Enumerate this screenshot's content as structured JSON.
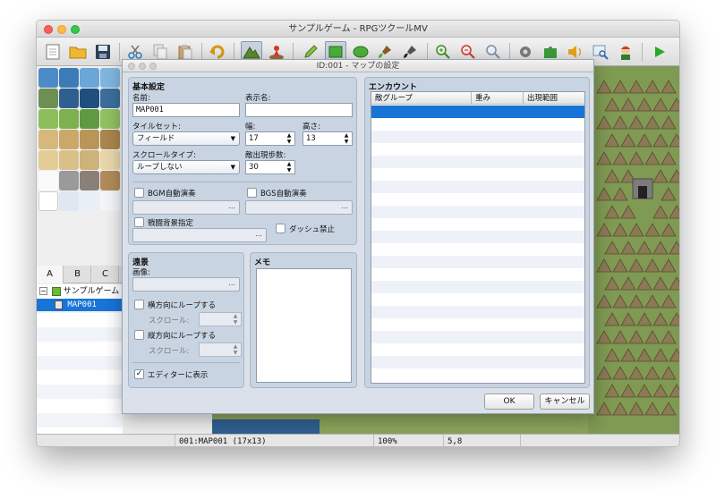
{
  "window": {
    "title": "サンプルゲーム - RPGツクールMV"
  },
  "toolbar": {
    "buttons": [
      "new-project",
      "open-project",
      "save-project",
      "cut",
      "copy",
      "paste",
      "undo",
      "map-mode",
      "event-mode",
      "pencil",
      "rectangle",
      "ellipse",
      "flood-fill",
      "shadow-pen",
      "zoom-in",
      "zoom-out",
      "actual-size",
      "database",
      "plugin-manager",
      "sound-test",
      "event-searcher",
      "character-generator",
      "playtest"
    ],
    "active": "map-mode"
  },
  "tileset_tabs": [
    "A",
    "B",
    "C"
  ],
  "project_tree": {
    "root": "サンプルゲーム",
    "selected_map": "MAP001"
  },
  "status": {
    "map": "001:MAP001 (17x13)",
    "zoom": "100%",
    "coords": "5,8"
  },
  "dialog": {
    "title": "ID:001 - マップの設定",
    "general": {
      "section_title": "基本設定",
      "name_label": "名前:",
      "name_value": "MAP001",
      "display_name_label": "表示名:",
      "display_name_value": "",
      "tileset_label": "タイルセット:",
      "tileset_value": "フィールド",
      "width_label": "幅:",
      "width_value": "17",
      "height_label": "高さ:",
      "height_value": "13",
      "scroll_type_label": "スクロールタイプ:",
      "scroll_type_value": "ループしない",
      "encounter_steps_label": "敵出現歩数:",
      "encounter_steps_value": "30",
      "autoplay_bgm_label": "BGM自動演奏",
      "autoplay_bgs_label": "BGS自動演奏",
      "battleback_label": "戦闘背景指定",
      "disable_dash_label": "ダッシュ禁止",
      "picker_dots": "..."
    },
    "parallax": {
      "section_title": "遠景",
      "image_label": "画像:",
      "loop_h_label": "横方向にループする",
      "loop_v_label": "縦方向にループする",
      "scroll_label": "スクロール:",
      "show_in_editor_label": "エディターに表示",
      "show_in_editor_checked": true
    },
    "memo": {
      "section_title": "メモ",
      "value": ""
    },
    "encounters": {
      "section_title": "エンカウント",
      "columns": [
        "敵グループ",
        "重み",
        "出現範囲"
      ]
    },
    "ok_label": "OK",
    "cancel_label": "キャンセル"
  },
  "colors": {
    "accent_selection": "#1874d6",
    "dialog_bg": "#dbe1ea",
    "panel_bg": "#c9d4e2"
  }
}
